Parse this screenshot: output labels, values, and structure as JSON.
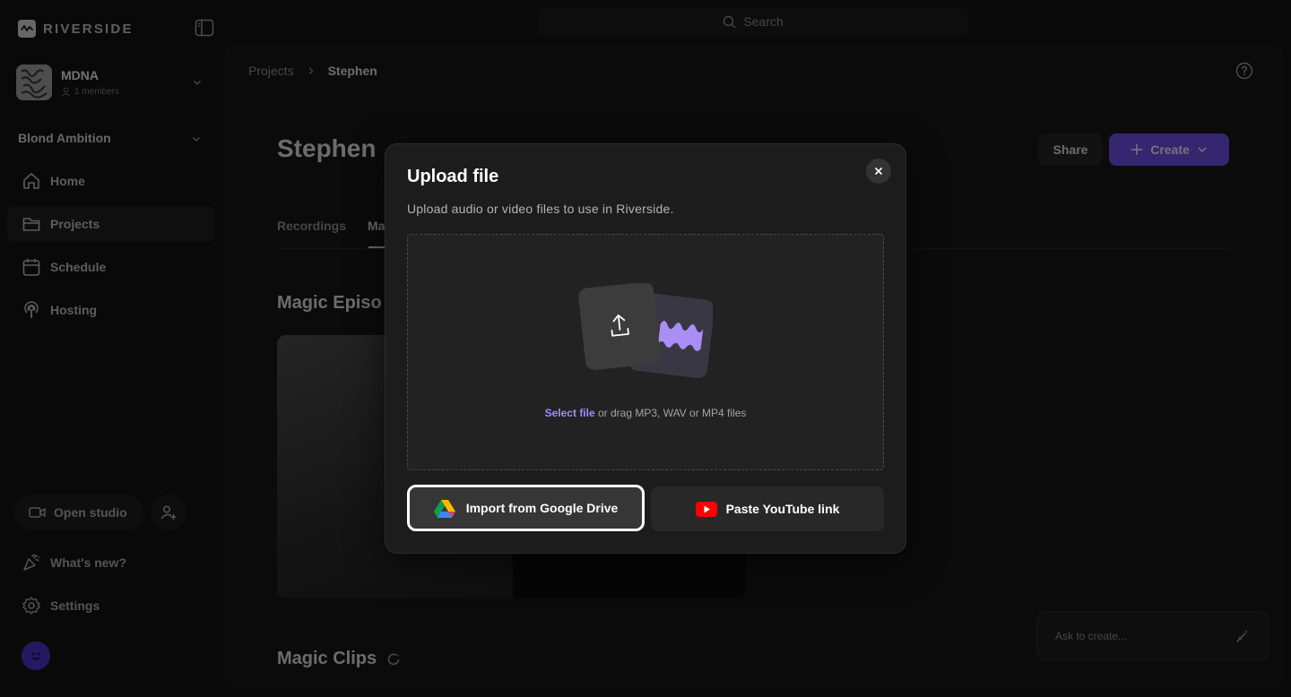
{
  "app": {
    "name": "RIVERSIDE"
  },
  "search": {
    "label": "Search"
  },
  "sidebar": {
    "workspace": {
      "name": "MDNA",
      "members": "1 members"
    },
    "section_title": "Blond Ambition",
    "nav": [
      {
        "label": "Home",
        "icon": "home-icon"
      },
      {
        "label": "Projects",
        "icon": "folder-icon",
        "active": true
      },
      {
        "label": "Schedule",
        "icon": "calendar-icon"
      },
      {
        "label": "Hosting",
        "icon": "podcast-icon"
      }
    ],
    "open_studio": "Open studio",
    "whats_new": "What's new?",
    "settings": "Settings"
  },
  "main": {
    "breadcrumb": {
      "parent": "Projects",
      "current": "Stephen"
    },
    "title": "Stephen",
    "share_label": "Share",
    "create_label": "Create",
    "tabs": [
      {
        "label": "Recordings"
      },
      {
        "label": "Ma",
        "active": true
      }
    ],
    "magic_episodes_heading": "Magic Episo",
    "magic_clips_heading": "Magic Clips",
    "ask_placeholder": "Ask to create..."
  },
  "modal": {
    "title": "Upload file",
    "subtitle": "Upload audio or video files to use in Riverside.",
    "select_file": "Select file",
    "drop_hint": " or drag MP3, WAV or MP4 files",
    "gdrive_label": "Import from Google Drive",
    "youtube_label": "Paste YouTube link"
  },
  "colors": {
    "accent": "#6a4ddf",
    "link": "#a08cff",
    "youtube_red": "#ff0000"
  }
}
